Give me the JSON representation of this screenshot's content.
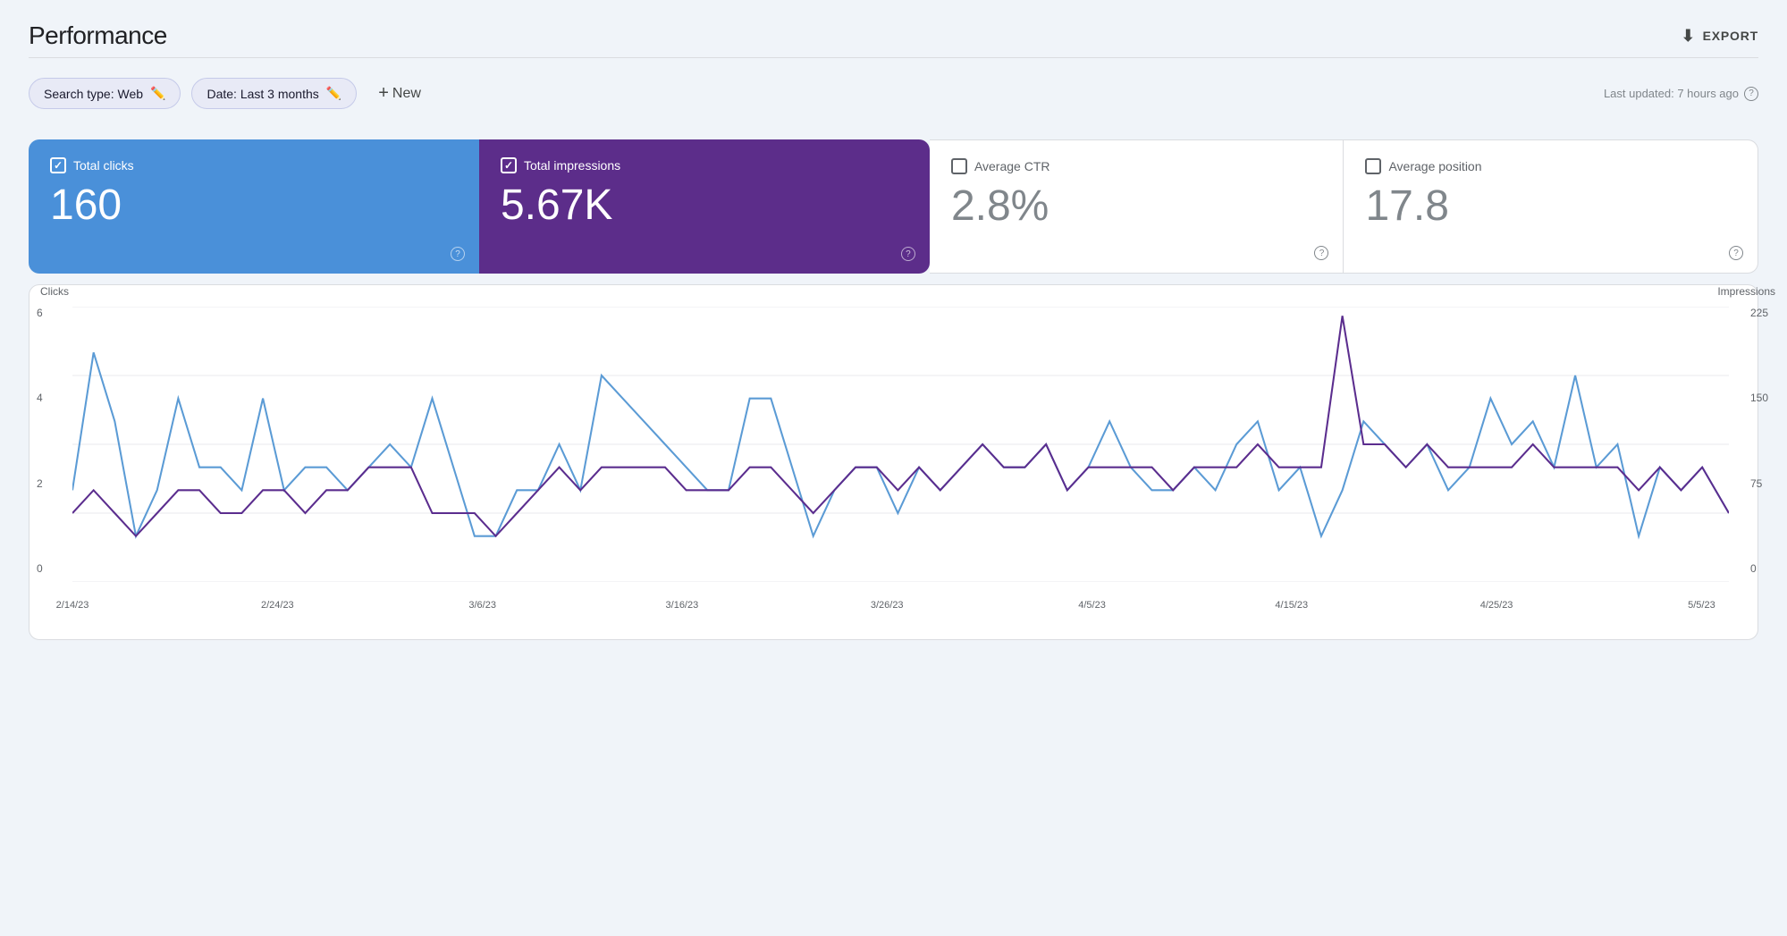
{
  "header": {
    "title": "Performance",
    "export_label": "EXPORT"
  },
  "filters": {
    "search_type_label": "Search type: Web",
    "date_label": "Date: Last 3 months",
    "new_label": "New",
    "last_updated": "Last updated: 7 hours ago"
  },
  "metrics": {
    "total_clicks": {
      "label": "Total clicks",
      "value": "160"
    },
    "total_impressions": {
      "label": "Total impressions",
      "value": "5.67K"
    },
    "average_ctr": {
      "label": "Average CTR",
      "value": "2.8%"
    },
    "average_position": {
      "label": "Average position",
      "value": "17.8"
    }
  },
  "chart": {
    "left_axis_title": "Clicks",
    "right_axis_title": "Impressions",
    "left_axis_labels": [
      "6",
      "4",
      "2",
      "0"
    ],
    "right_axis_labels": [
      "225",
      "150",
      "75",
      "0"
    ],
    "x_labels": [
      "2/14/23",
      "2/24/23",
      "3/6/23",
      "3/16/23",
      "3/26/23",
      "4/5/23",
      "4/15/23",
      "4/25/23",
      "5/5/23"
    ]
  },
  "colors": {
    "blue_metric": "#4a90d9",
    "purple_metric": "#5c2d8a",
    "blue_line": "#5b9bd5",
    "purple_line": "#4a2070",
    "grid": "#e8eaed"
  }
}
